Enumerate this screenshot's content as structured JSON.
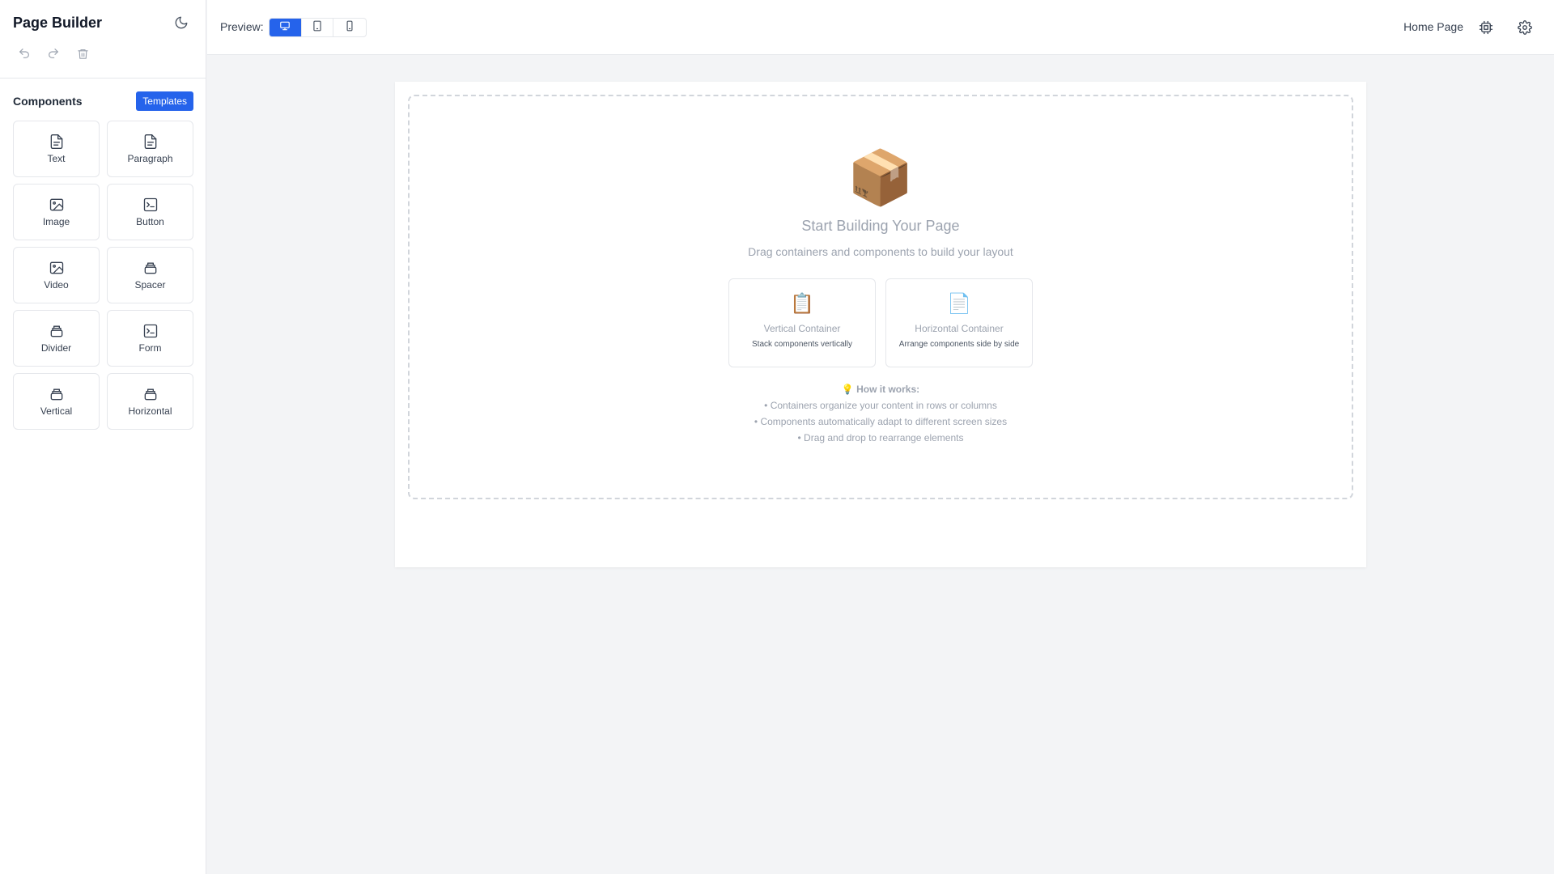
{
  "sidebar": {
    "title": "Page Builder",
    "components_heading": "Components",
    "templates_label": "Templates",
    "components": [
      {
        "label": "Text",
        "icon": "file-text-icon"
      },
      {
        "label": "Paragraph",
        "icon": "file-text-icon"
      },
      {
        "label": "Image",
        "icon": "image-icon"
      },
      {
        "label": "Button",
        "icon": "terminal-square-icon"
      },
      {
        "label": "Video",
        "icon": "image-icon"
      },
      {
        "label": "Spacer",
        "icon": "layers-icon"
      },
      {
        "label": "Divider",
        "icon": "layers-icon"
      },
      {
        "label": "Form",
        "icon": "terminal-square-icon"
      },
      {
        "label": "Vertical",
        "icon": "layers-icon"
      },
      {
        "label": "Horizontal",
        "icon": "layers-icon"
      }
    ]
  },
  "topbar": {
    "preview_label": "Preview:",
    "devices": [
      "desktop-icon",
      "tablet-icon",
      "mobile-icon"
    ],
    "active_device": "desktop",
    "page_name": "Home Page"
  },
  "canvas": {
    "empty_emoji": "📦",
    "title": "Start Building Your Page",
    "subtitle": "Drag containers and components to build your layout",
    "cards": [
      {
        "emoji": "📋",
        "title": "Vertical Container",
        "desc": "Stack components vertically"
      },
      {
        "emoji": "📄",
        "title": "Horizontal Container",
        "desc": "Arrange components side by side"
      }
    ],
    "how_title": "💡 How it works:",
    "how_items": [
      "• Containers organize your content in rows or columns",
      "• Components automatically adapt to different screen sizes",
      "• Drag and drop to rearrange elements"
    ]
  },
  "colors": {
    "accent": "#2563eb",
    "muted": "#9ca3af",
    "border": "#e5e7eb"
  }
}
